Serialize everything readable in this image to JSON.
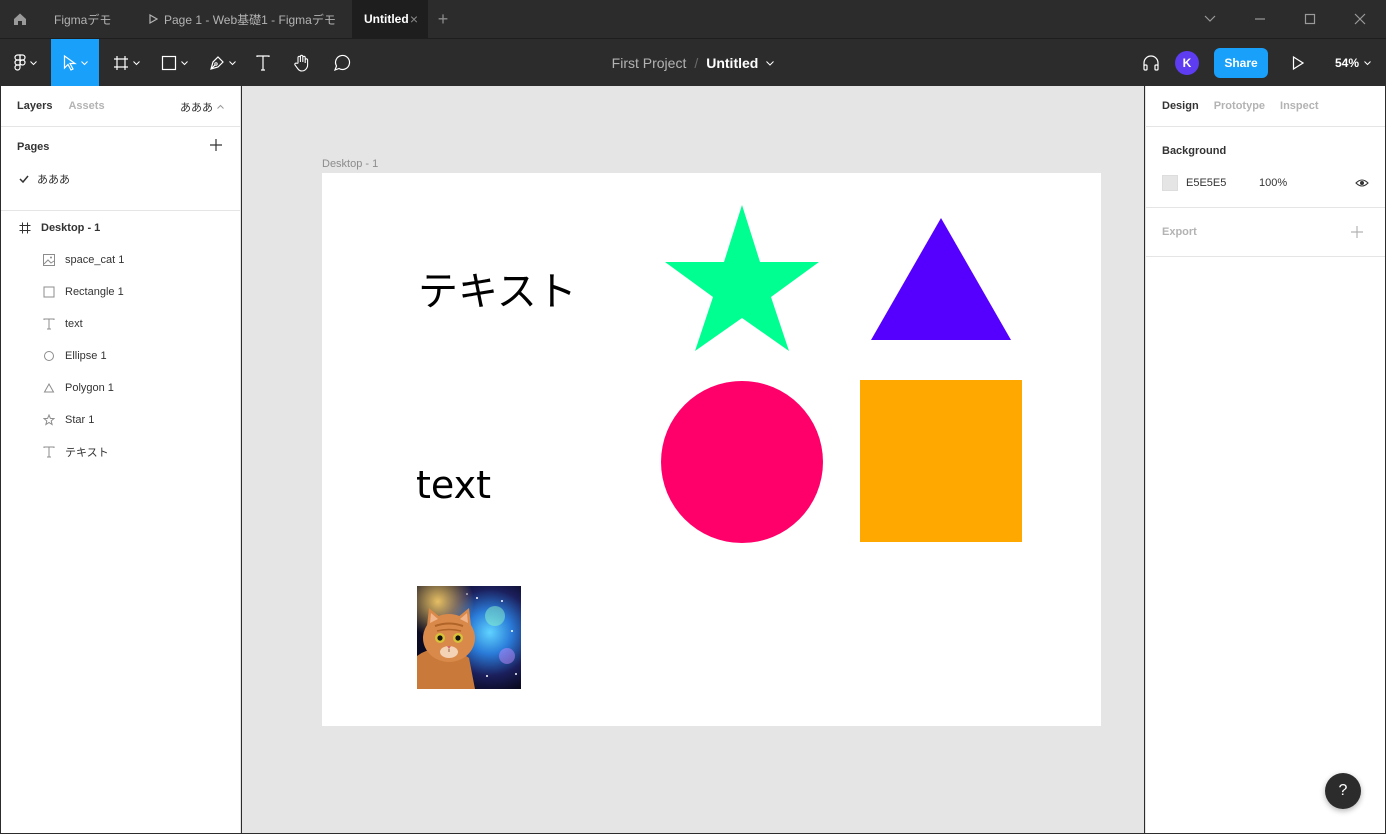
{
  "tabs": {
    "items": [
      {
        "label": "Figmaデモ"
      },
      {
        "label": "Page 1 - Web基礎1 - Figmaデモ"
      },
      {
        "label": "Untitled"
      }
    ]
  },
  "toolbar": {
    "project": "First Project",
    "separator": "/",
    "file": "Untitled",
    "avatar_initial": "K",
    "share_label": "Share",
    "zoom": "54%",
    "accent_color": "#18a0fb"
  },
  "left_panel": {
    "tabs": [
      "Layers",
      "Assets"
    ],
    "current_page": "あああ",
    "pages_title": "Pages",
    "pages": [
      {
        "label": "あああ",
        "selected": true
      }
    ],
    "layers": [
      {
        "label": "Desktop - 1",
        "icon": "frame-icon"
      },
      {
        "label": "space_cat 1",
        "icon": "image-icon"
      },
      {
        "label": "Rectangle 1",
        "icon": "rectangle-icon"
      },
      {
        "label": "text",
        "icon": "text-icon"
      },
      {
        "label": "Ellipse 1",
        "icon": "ellipse-icon"
      },
      {
        "label": "Polygon 1",
        "icon": "polygon-icon"
      },
      {
        "label": "Star 1",
        "icon": "star-icon"
      },
      {
        "label": "テキスト",
        "icon": "text-icon"
      }
    ]
  },
  "canvas": {
    "frame_label": "Desktop - 1",
    "jp_text": "テキスト",
    "en_text": "text",
    "colors": {
      "star": "#00ff91",
      "triangle": "#5500ff",
      "circle": "#ff006b",
      "square": "#ffa800"
    }
  },
  "right_panel": {
    "tabs": [
      "Design",
      "Prototype",
      "Inspect"
    ],
    "background_title": "Background",
    "background_hex": "E5E5E5",
    "background_opacity": "100%",
    "export_title": "Export"
  },
  "help_label": "?"
}
